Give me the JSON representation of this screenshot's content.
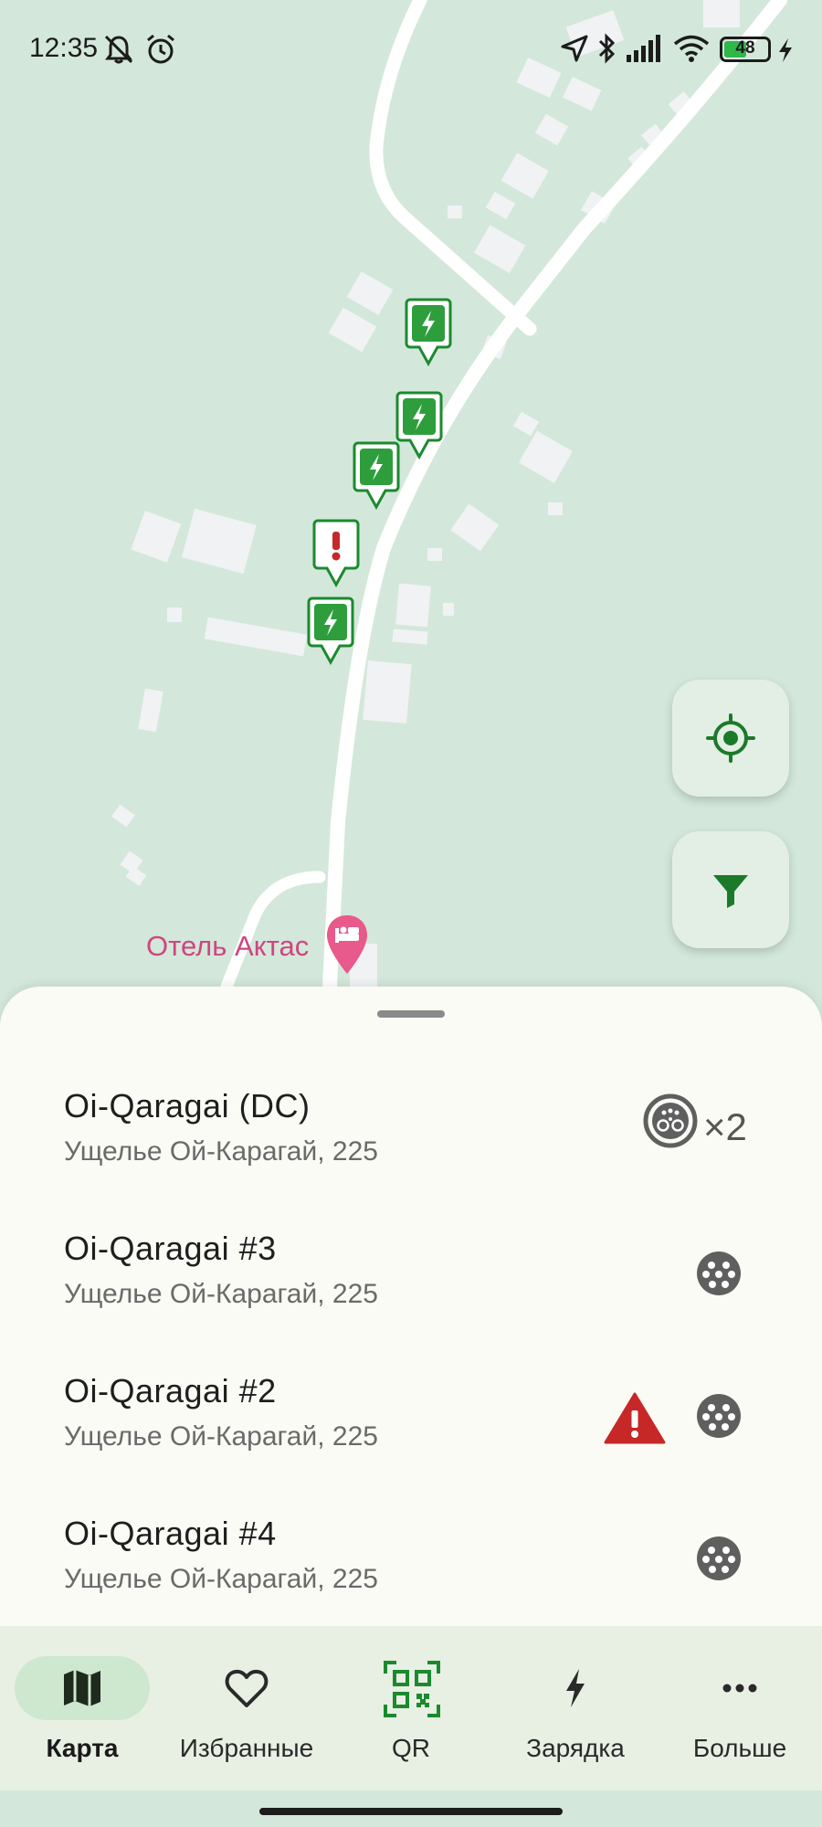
{
  "status_bar": {
    "time": "12:35",
    "battery": "48",
    "icons": [
      "mute-icon",
      "alarm-icon",
      "location-icon",
      "bluetooth-icon",
      "signal-icon",
      "wifi-icon",
      "battery-icon",
      "charging-icon"
    ]
  },
  "map": {
    "poi_label": "Отель Актас",
    "pins": [
      {
        "kind": "station"
      },
      {
        "kind": "station"
      },
      {
        "kind": "station"
      },
      {
        "kind": "error"
      },
      {
        "kind": "station"
      }
    ],
    "buttons": [
      "my-location-icon",
      "filter-icon"
    ]
  },
  "stations": [
    {
      "name": "Oi-Qaragai (DC)",
      "address": "Ущелье Ой-Карагай, 225",
      "connector": "ccs-icon",
      "count": "×2",
      "warning": false
    },
    {
      "name": "Oi-Qaragai #3",
      "address": "Ущелье Ой-Карагай, 225",
      "connector": "type2-icon",
      "count": "",
      "warning": false
    },
    {
      "name": "Oi-Qaragai #2",
      "address": "Ущелье Ой-Карагай, 225",
      "connector": "type2-icon",
      "count": "",
      "warning": true
    },
    {
      "name": "Oi-Qaragai #4",
      "address": "Ущелье Ой-Карагай, 225",
      "connector": "type2-icon",
      "count": "",
      "warning": false
    }
  ],
  "nav": {
    "items": [
      {
        "label": "Карта",
        "icon": "map-icon",
        "active": true
      },
      {
        "label": "Избранные",
        "icon": "heart-icon",
        "active": false
      },
      {
        "label": "QR",
        "icon": "qr-code-icon",
        "active": false
      },
      {
        "label": "Зарядка",
        "icon": "bolt-icon",
        "active": false
      },
      {
        "label": "Больше",
        "icon": "more-icon",
        "active": false
      }
    ]
  },
  "colors": {
    "accent": "#1b8a2e",
    "map_bg": "#d3e8da",
    "error": "#c62828",
    "poi": "#d0457e"
  }
}
